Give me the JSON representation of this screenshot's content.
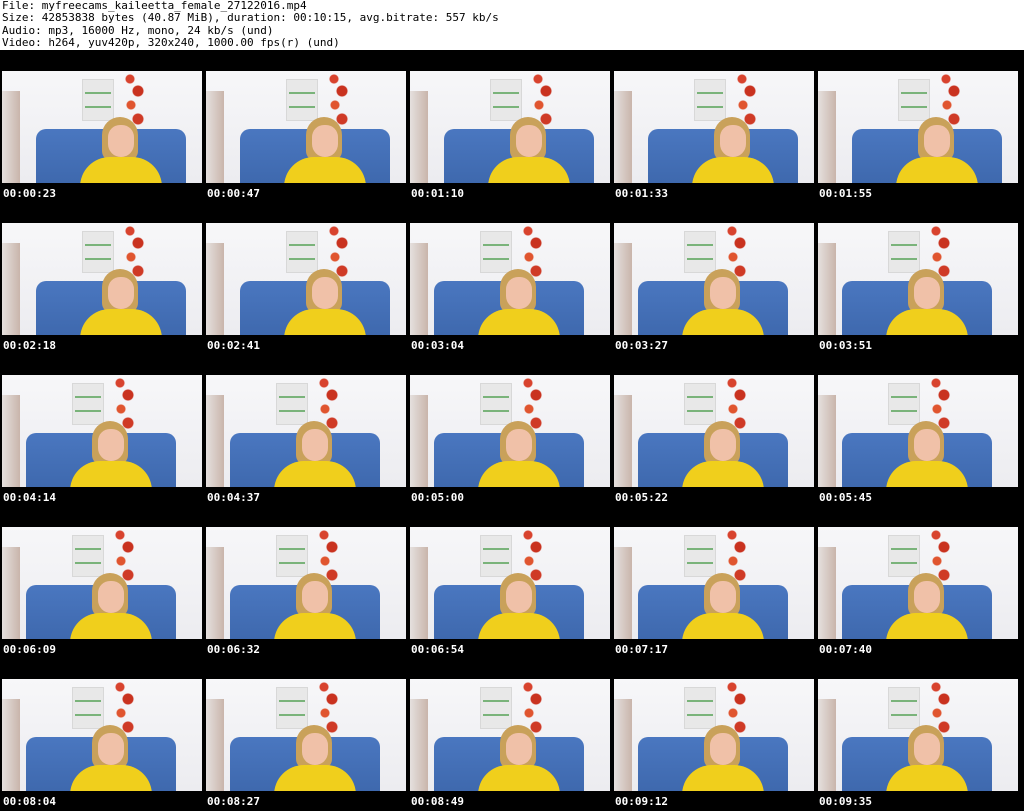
{
  "header": {
    "file": "File: myfreecams_kaileetta_female_27122016.mp4",
    "size": "Size: 42853838 bytes (40.87 MiB), duration: 00:10:15, avg.bitrate: 557 kb/s",
    "audio": "Audio: mp3, 16000 Hz, mono, 24 kb/s (und)",
    "video": "Video: h264, yuv420p, 320x240, 1000.00 fps(r) (und)"
  },
  "thumbnails": [
    {
      "timestamp": "00:00:23"
    },
    {
      "timestamp": "00:00:47"
    },
    {
      "timestamp": "00:01:10"
    },
    {
      "timestamp": "00:01:33"
    },
    {
      "timestamp": "00:01:55"
    },
    {
      "timestamp": "00:02:18"
    },
    {
      "timestamp": "00:02:41"
    },
    {
      "timestamp": "00:03:04"
    },
    {
      "timestamp": "00:03:27"
    },
    {
      "timestamp": "00:03:51"
    },
    {
      "timestamp": "00:04:14"
    },
    {
      "timestamp": "00:04:37"
    },
    {
      "timestamp": "00:05:00"
    },
    {
      "timestamp": "00:05:22"
    },
    {
      "timestamp": "00:05:45"
    },
    {
      "timestamp": "00:06:09"
    },
    {
      "timestamp": "00:06:32"
    },
    {
      "timestamp": "00:06:54"
    },
    {
      "timestamp": "00:07:17"
    },
    {
      "timestamp": "00:07:40"
    },
    {
      "timestamp": "00:08:04"
    },
    {
      "timestamp": "00:08:27"
    },
    {
      "timestamp": "00:08:49"
    },
    {
      "timestamp": "00:09:12"
    },
    {
      "timestamp": "00:09:35"
    }
  ]
}
